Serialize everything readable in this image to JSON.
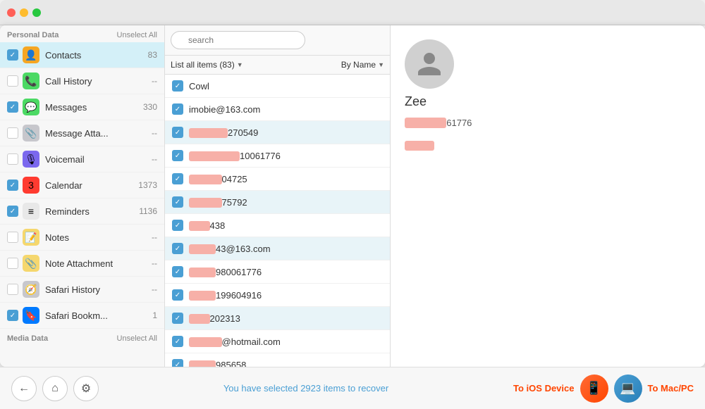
{
  "titlebar": {
    "buttons": [
      "close",
      "minimize",
      "maximize"
    ]
  },
  "sidebar": {
    "personal_section": "Personal Data",
    "personal_unselect": "Unselect All",
    "media_section": "Media Data",
    "media_unselect": "Unselect All",
    "items": [
      {
        "id": "contacts",
        "label": "Contacts",
        "count": "83",
        "checked": true,
        "active": true,
        "icon": "contacts"
      },
      {
        "id": "call-history",
        "label": "Call History",
        "count": "--",
        "checked": false,
        "active": false,
        "icon": "call"
      },
      {
        "id": "messages",
        "label": "Messages",
        "count": "330",
        "checked": true,
        "active": false,
        "icon": "messages"
      },
      {
        "id": "message-attachments",
        "label": "Message Atta...",
        "count": "--",
        "checked": false,
        "active": false,
        "icon": "msgatt"
      },
      {
        "id": "voicemail",
        "label": "Voicemail",
        "count": "--",
        "checked": false,
        "active": false,
        "icon": "voicemail"
      },
      {
        "id": "calendar",
        "label": "Calendar",
        "count": "1373",
        "checked": true,
        "active": false,
        "icon": "calendar"
      },
      {
        "id": "reminders",
        "label": "Reminders",
        "count": "1136",
        "checked": true,
        "active": false,
        "icon": "reminders"
      },
      {
        "id": "notes",
        "label": "Notes",
        "count": "--",
        "checked": false,
        "active": false,
        "icon": "notes"
      },
      {
        "id": "note-attachments",
        "label": "Note Attachment",
        "count": "--",
        "checked": false,
        "active": false,
        "icon": "noteatt"
      },
      {
        "id": "safari-history",
        "label": "Safari History",
        "count": "--",
        "checked": false,
        "active": false,
        "icon": "safari"
      },
      {
        "id": "safari-bookmarks",
        "label": "Safari Bookm...",
        "count": "1",
        "checked": true,
        "active": false,
        "icon": "safaribm"
      }
    ]
  },
  "list_panel": {
    "search_placeholder": "search",
    "list_all_label": "List all items (83)",
    "sort_label": "By Name",
    "items": [
      {
        "name": "Cowl",
        "blurred": false,
        "checked": true,
        "highlighted": false
      },
      {
        "name": "imobie@163.com",
        "blurred": false,
        "checked": true,
        "highlighted": false
      },
      {
        "name_prefix": "",
        "name_blurred": "██████",
        "name_suffix": "270549",
        "checked": true,
        "highlighted": true
      },
      {
        "name_prefix": "",
        "name_blurred": "████████",
        "name_suffix": "10061776",
        "checked": true,
        "highlighted": false
      },
      {
        "name_prefix": "",
        "name_blurred": "█████",
        "name_suffix": "04725",
        "checked": true,
        "highlighted": false
      },
      {
        "name_prefix": "",
        "name_blurred": "█████",
        "name_suffix": "75792",
        "checked": true,
        "highlighted": true
      },
      {
        "name_prefix": "",
        "name_blurred": "███",
        "name_suffix": "438",
        "checked": true,
        "highlighted": false
      },
      {
        "name_prefix": "",
        "name_blurred": "████",
        "name_suffix": "43@163.com",
        "checked": true,
        "highlighted": true
      },
      {
        "name_prefix": "",
        "name_blurred": "████",
        "name_suffix": "980061776",
        "checked": true,
        "highlighted": false
      },
      {
        "name_prefix": "",
        "name_blurred": "████",
        "name_suffix": "199604916",
        "checked": true,
        "highlighted": false
      },
      {
        "name_prefix": "",
        "name_blurred": "███",
        "name_suffix": "202313",
        "checked": true,
        "highlighted": true
      },
      {
        "name_prefix": "",
        "name_blurred": "█████",
        "name_suffix": "@hotmail.com",
        "checked": true,
        "highlighted": false
      },
      {
        "name_prefix": "",
        "name_blurred": "████",
        "name_suffix": "985658",
        "checked": true,
        "highlighted": false
      }
    ]
  },
  "detail": {
    "contact_name": "Zee",
    "phone_blurred": "██████",
    "phone_suffix": "61776",
    "label_blurred": "████"
  },
  "bottom_bar": {
    "status_prefix": "You have selected ",
    "status_count": "2923",
    "status_suffix": " items to recover",
    "ios_label": "To iOS Device",
    "mac_label": "To Mac/PC"
  }
}
